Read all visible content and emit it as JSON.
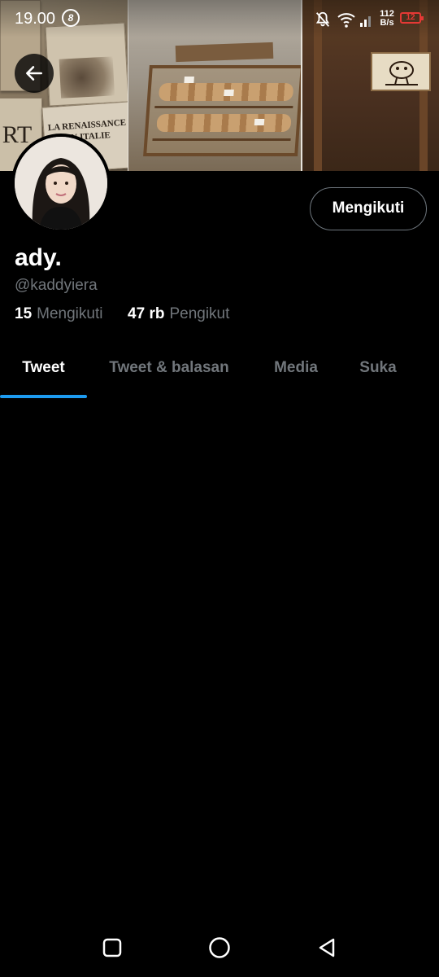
{
  "status_bar": {
    "time": "19.00",
    "badge": "8",
    "net_speed_value": "112",
    "net_speed_unit": "B/s",
    "battery": "12"
  },
  "banner": {
    "book_title_line1": "LA RENAISSANCE",
    "book_title_line2": "EN ITALIE",
    "book_side_text": "RT"
  },
  "profile": {
    "display_name": "ady.",
    "handle": "@kaddyiera",
    "follow_button_label": "Mengikuti",
    "following_count": "15",
    "following_label": "Mengikuti",
    "followers_count": "47 rb",
    "followers_label": "Pengikut"
  },
  "tabs": [
    {
      "label": "Tweet",
      "active": true
    },
    {
      "label": "Tweet & balasan",
      "active": false
    },
    {
      "label": "Media",
      "active": false
    },
    {
      "label": "Suka",
      "active": false
    }
  ],
  "colors": {
    "accent": "#1d9bf0",
    "secondary_text": "#71767b",
    "background": "#000000",
    "battery_low": "#e53935"
  },
  "icons": {
    "back": "arrow-left-icon",
    "mute": "bell-off-icon",
    "wifi": "wifi-icon",
    "signal": "signal-icon",
    "nav_recents": "square-icon",
    "nav_home": "circle-icon",
    "nav_back": "triangle-back-icon"
  }
}
